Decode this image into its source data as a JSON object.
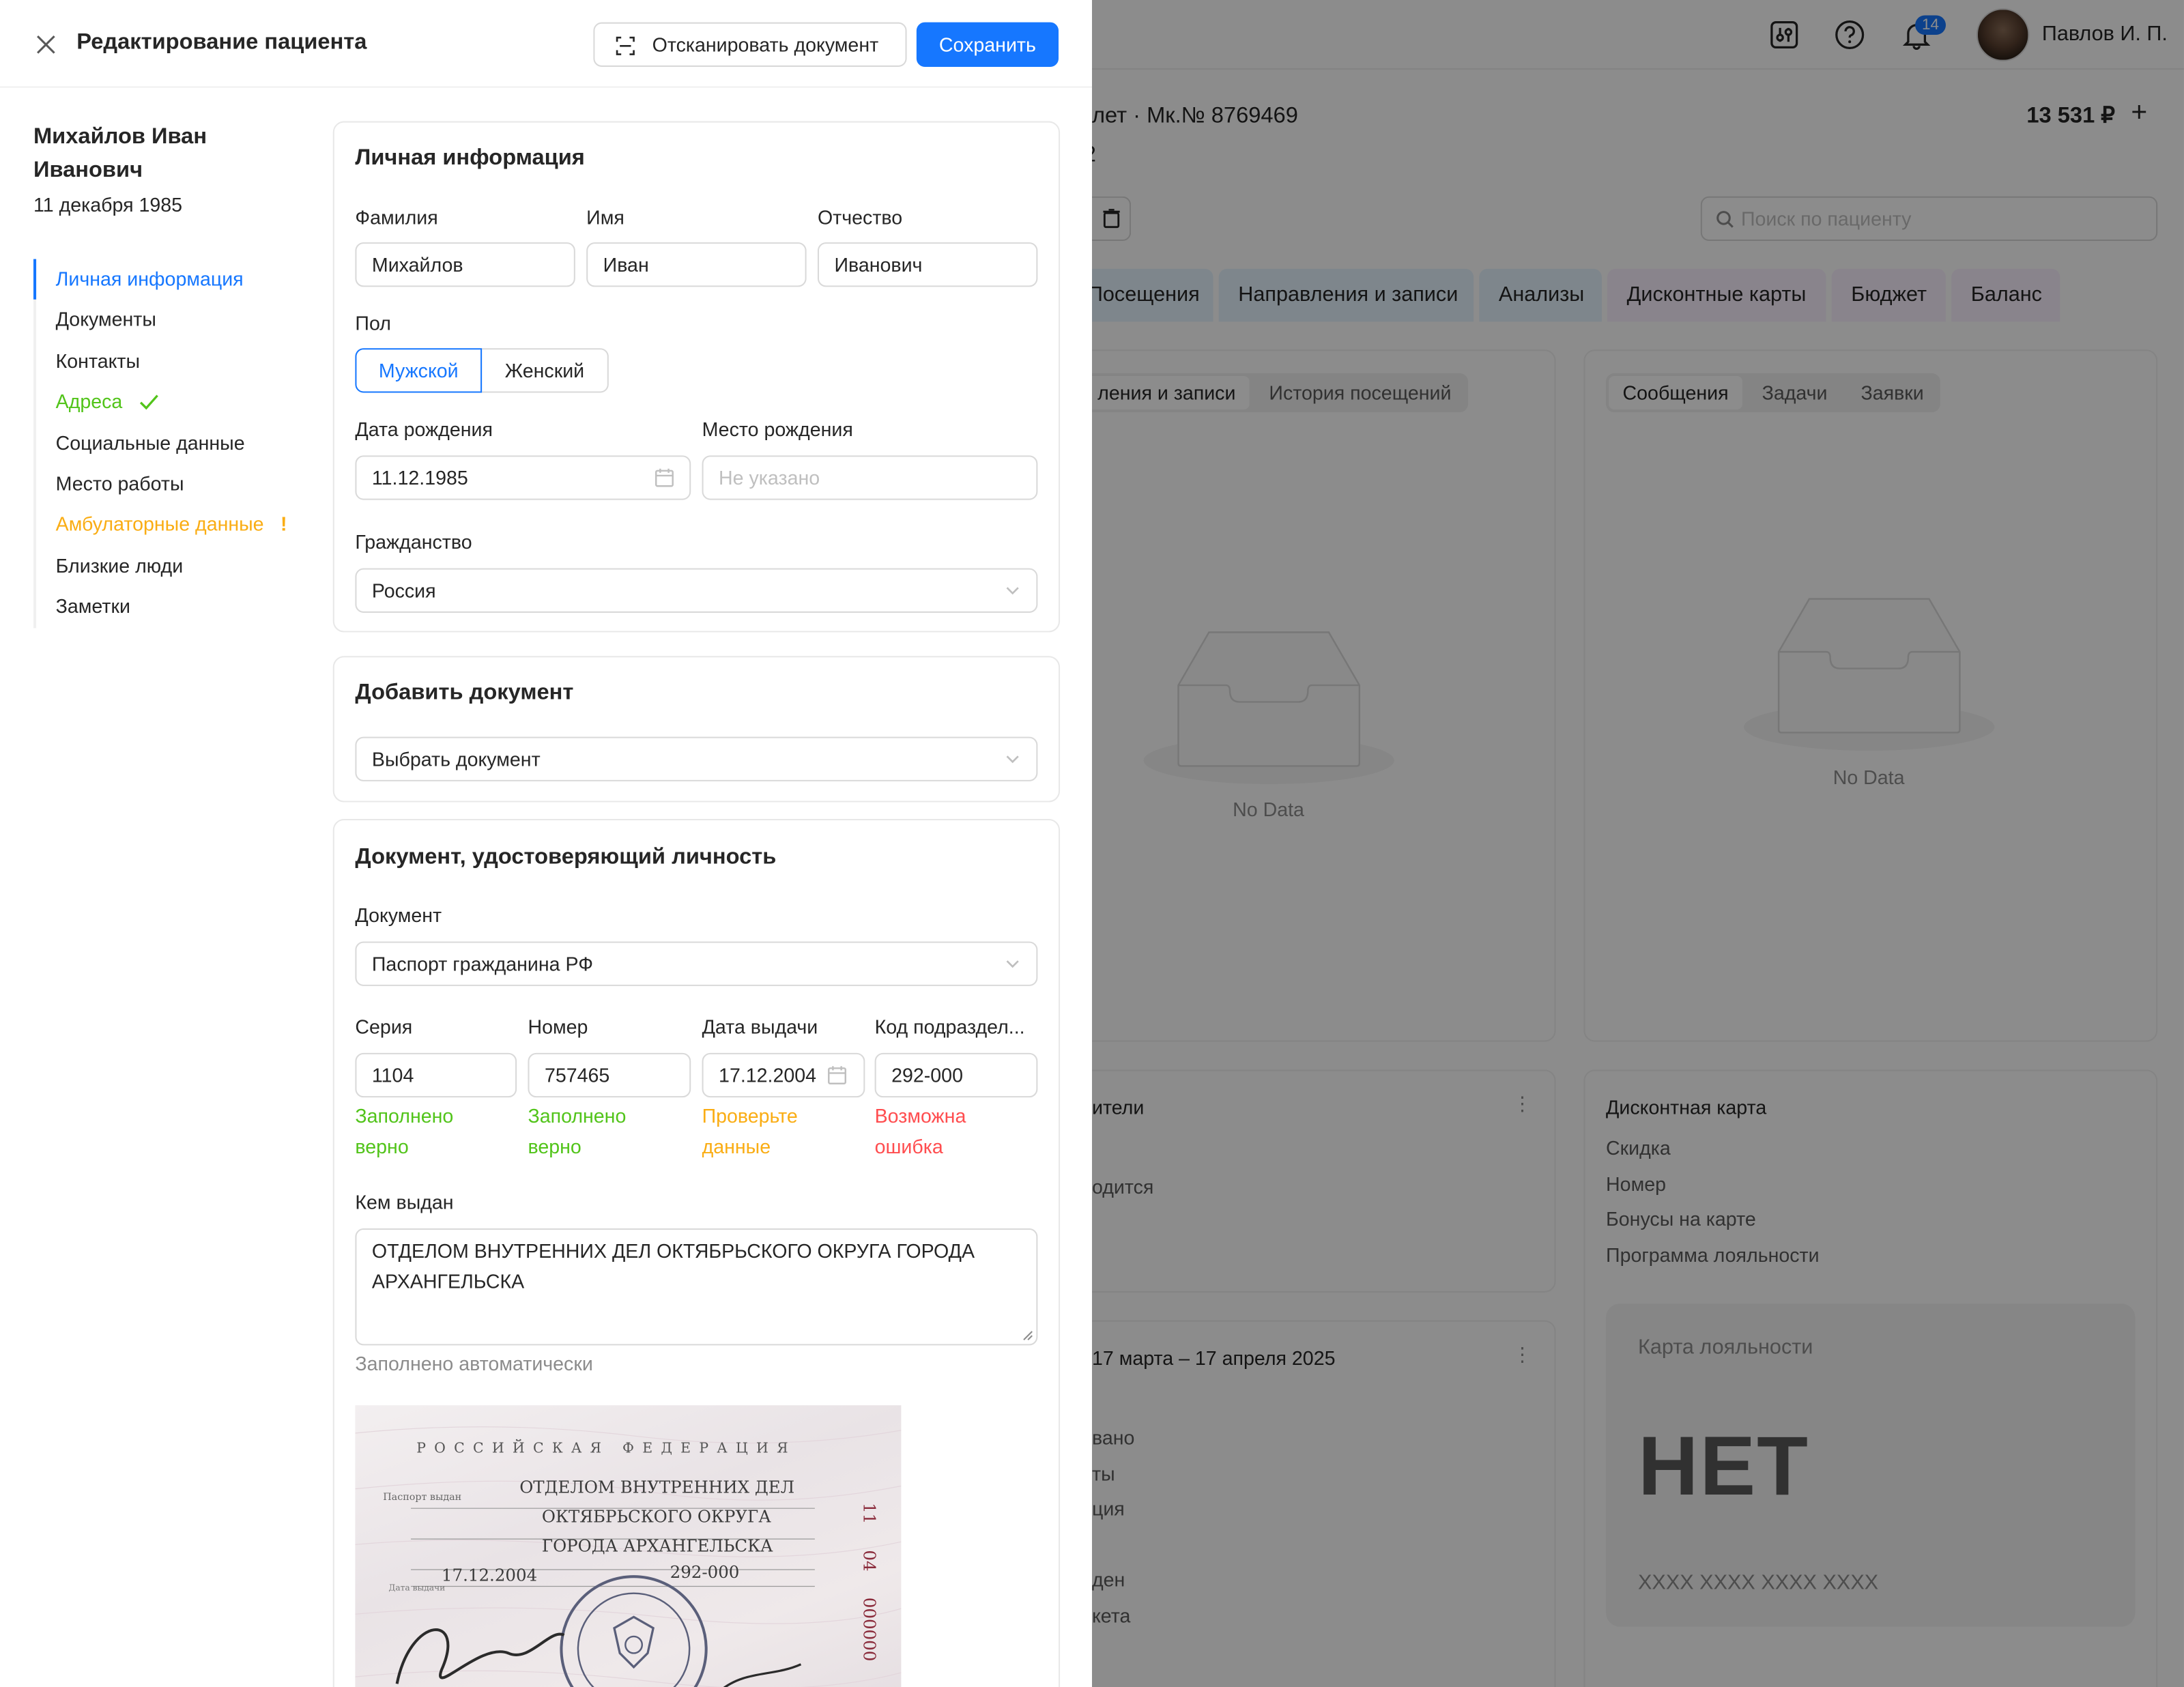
{
  "background": {
    "header": {
      "user_name": "Павлов И. П.",
      "notifications_count": "14",
      "icons": [
        "sliders-icon",
        "help-icon",
        "bell-icon"
      ]
    },
    "patient_meta": "лет · Мк.№ 8769469",
    "balance": "13 531 ₽",
    "search_placeholder": "Поиск по пациенту",
    "tabs": [
      "Посещения",
      "Направления и записи",
      "Анализы",
      "Дисконтные карты",
      "Бюджет",
      "Баланс"
    ],
    "left_card": {
      "tabs": [
        "ления и записи",
        "История посещений"
      ],
      "empty": "No Data"
    },
    "right_card": {
      "tabs": [
        "Сообщения",
        "Задачи",
        "Заявки"
      ],
      "empty": "No Data"
    },
    "representatives": {
      "title": "ители",
      "row": "одится"
    },
    "period": {
      "title": "17 марта – 17 апреля 2025",
      "rows": [
        "вано",
        "ты",
        "ция",
        "ден",
        "кета"
      ]
    },
    "discount": {
      "title": "Дисконтная карта",
      "rows": [
        "Скидка",
        "Номер",
        "Бонусы на карте",
        "Программа лояльности"
      ],
      "loyalty_title": "Карта лояльности",
      "loyalty_value": "НЕТ",
      "loyalty_number": "XXXX XXXX XXXX XXXX"
    }
  },
  "drawer": {
    "title": "Редактирование пациента",
    "scan_button": "Отсканировать документ",
    "save_button": "Сохранить",
    "patient_name": "Михайлов Иван Иванович",
    "patient_birth": "11 декабря 1985",
    "nav": [
      {
        "label": "Личная информация",
        "state": "active"
      },
      {
        "label": "Документы",
        "state": "normal"
      },
      {
        "label": "Контакты",
        "state": "normal"
      },
      {
        "label": "Адреса",
        "state": "ok"
      },
      {
        "label": "Социальные данные",
        "state": "normal"
      },
      {
        "label": "Место работы",
        "state": "normal"
      },
      {
        "label": "Амбулаторные данные",
        "state": "warning"
      },
      {
        "label": "Близкие люди",
        "state": "normal"
      },
      {
        "label": "Заметки",
        "state": "normal"
      }
    ],
    "personal": {
      "title": "Личная информация",
      "surname_label": "Фамилия",
      "surname": "Михайлов",
      "name_label": "Имя",
      "name": "Иван",
      "patronymic_label": "Отчество",
      "patronymic": "Иванович",
      "gender_label": "Пол",
      "gender_male": "Мужской",
      "gender_female": "Женский",
      "gender_selected": "Мужской",
      "birthdate_label": "Дата рождения",
      "birthdate": "11.12.1985",
      "birthplace_label": "Место рождения",
      "birthplace_placeholder": "Не указано",
      "citizenship_label": "Гражданство",
      "citizenship": "Россия"
    },
    "add_document": {
      "title": "Добавить документ",
      "placeholder": "Выбрать документ"
    },
    "identity": {
      "title": "Документ, удостоверяющий личность",
      "doc_label": "Документ",
      "doc": "Паспорт гражданина РФ",
      "series_label": "Серия",
      "series": "1104",
      "series_hint": [
        "Заполнено",
        "верно"
      ],
      "number_label": "Номер",
      "number": "757465",
      "number_hint": [
        "Заполнено",
        "верно"
      ],
      "issue_date_label": "Дата выдачи",
      "issue_date": "17.12.2004",
      "issue_date_hint": [
        "Проверьте",
        "данные"
      ],
      "code_label": "Код подраздел...",
      "code": "292-000",
      "code_hint": [
        "Возможна",
        "ошибка"
      ],
      "issued_by_label": "Кем выдан",
      "issued_by": "ОТДЕЛОМ ВНУТРЕННИХ ДЕЛ ОКТЯБРЬСКОГО ОКРУГА ГОРОДА АРХАНГЕЛЬСКА",
      "auto_hint": "Заполнено автоматически"
    },
    "scan_image": {
      "header": "РОССИЙСКАЯ ФЕДЕРАЦИЯ",
      "issued_caption": "Паспорт выдан",
      "lines": [
        "ОТДЕЛОМ ВНУТРЕННИХ ДЕЛ",
        "ОКТЯБРЬСКОГО ОКРУГА",
        "ГОРОДА АРХАНГЕЛЬСКА"
      ],
      "date": "17.12.2004",
      "date_caption": "Дата выдачи",
      "code": "292-000",
      "side": [
        "11",
        "04",
        "000000"
      ]
    }
  },
  "colors": {
    "primary": "#1677ff",
    "success": "#52c41a",
    "warning": "#faad14",
    "error": "#ff4d4f"
  }
}
